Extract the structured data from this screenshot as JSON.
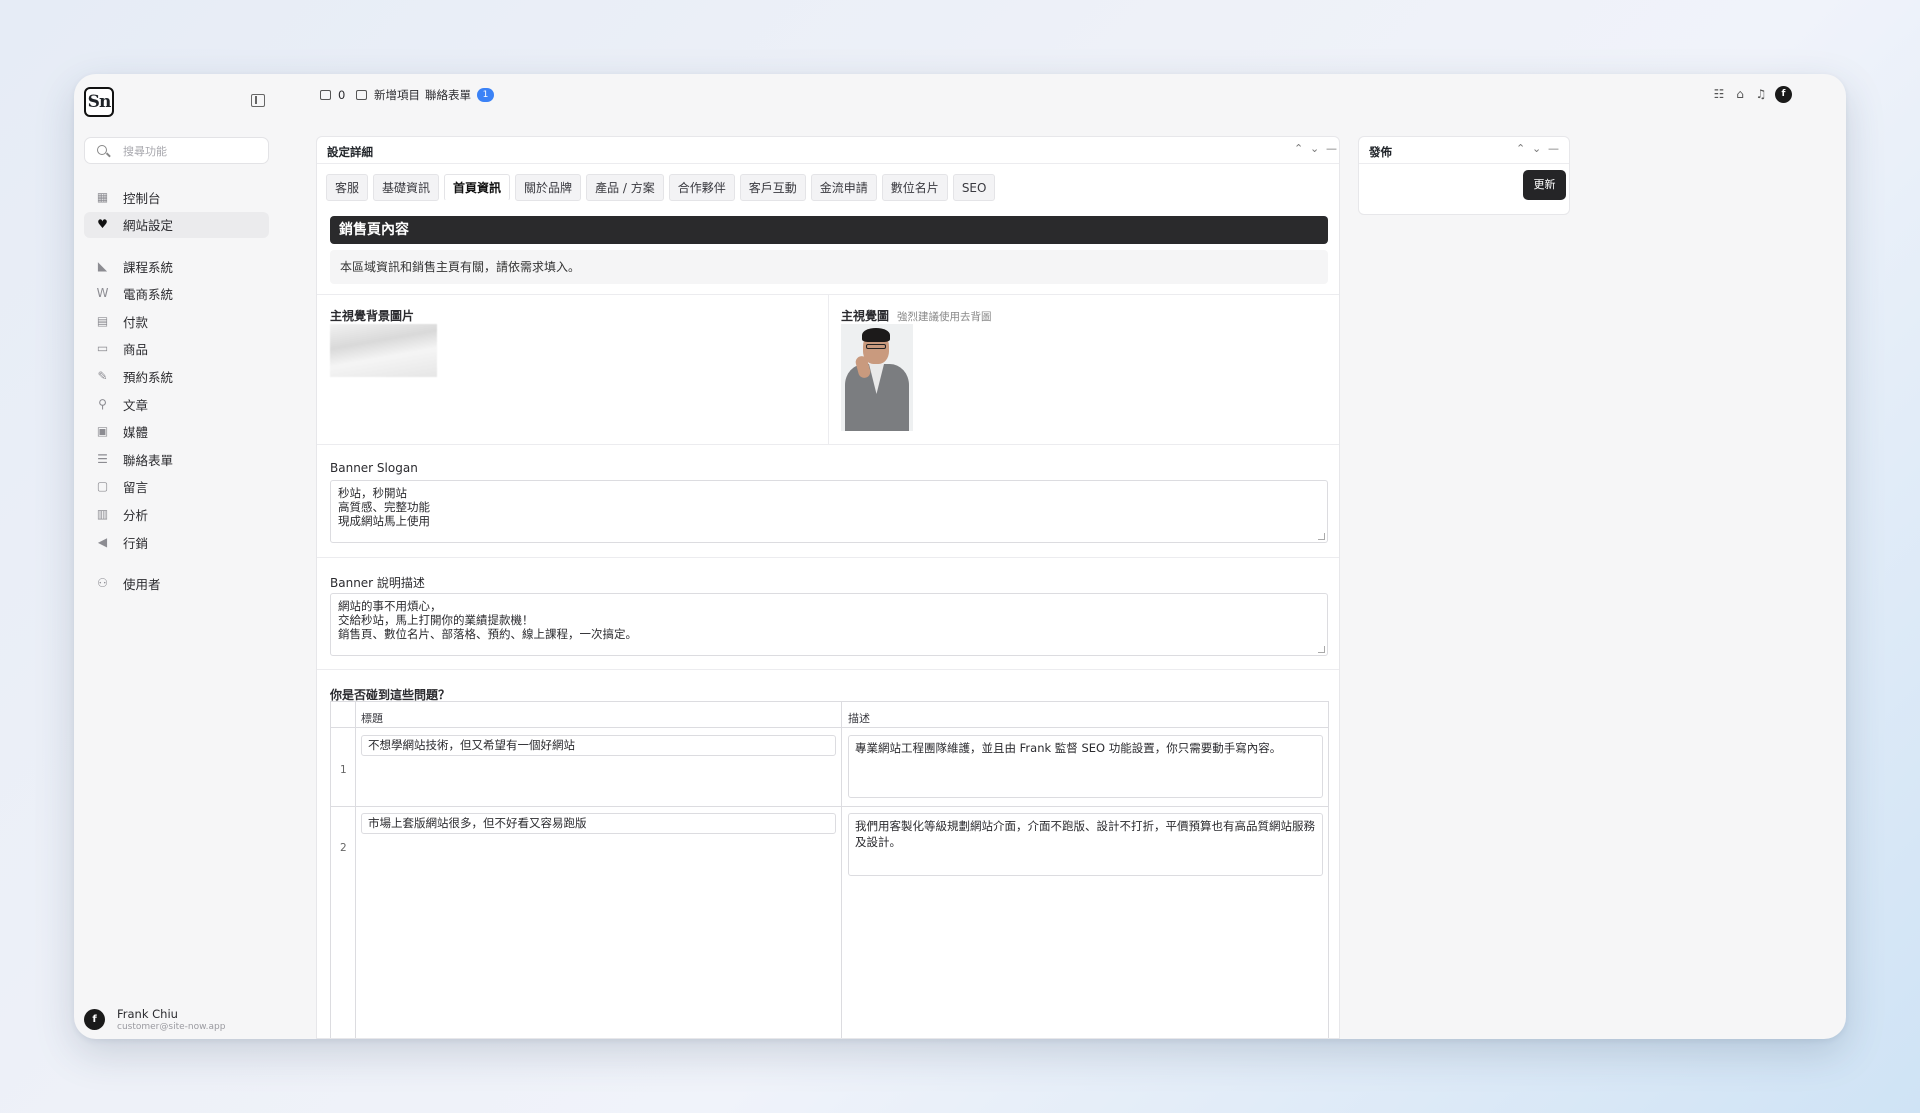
{
  "sidebar": {
    "logo_text": "Sn",
    "search_placeholder": "搜尋功能",
    "items": [
      {
        "label": "控制台",
        "icon": "dashboard-icon"
      },
      {
        "label": "網站設定",
        "icon": "heart-icon",
        "active": true
      },
      {
        "label": "課程系統",
        "icon": "course-icon"
      },
      {
        "label": "電商系統",
        "icon": "woo-icon"
      },
      {
        "label": "付款",
        "icon": "payment-icon"
      },
      {
        "label": "商品",
        "icon": "archive-icon"
      },
      {
        "label": "預約系統",
        "icon": "booking-icon"
      },
      {
        "label": "文章",
        "icon": "pin-icon"
      },
      {
        "label": "媒體",
        "icon": "media-icon"
      },
      {
        "label": "聯絡表單",
        "icon": "form-icon"
      },
      {
        "label": "留言",
        "icon": "comment-icon"
      },
      {
        "label": "分析",
        "icon": "chart-icon"
      },
      {
        "label": "行銷",
        "icon": "megaphone-icon"
      },
      {
        "label": "使用者",
        "icon": "users-icon"
      }
    ],
    "user": {
      "name": "Frank Chiu",
      "email": "customer@site-now.app",
      "avatar_letter": "f"
    }
  },
  "topbar": {
    "comments_count": "0",
    "new_item_label": "新增項目",
    "contact_form_label": "聯絡表單",
    "contact_form_badge": "1",
    "avatar_letter": "f"
  },
  "panel": {
    "title": "設定詳細",
    "tabs": [
      "客服",
      "基礎資訊",
      "首頁資訊",
      "關於品牌",
      "產品 / 方案",
      "合作夥伴",
      "客戶互動",
      "金流申請",
      "數位名片",
      "SEO"
    ],
    "active_tab": "首頁資訊",
    "section_title": "銷售頁內容",
    "notice": "本區域資訊和銷售主頁有關，請依需求填入。",
    "hero_bg_label": "主視覺背景圖片",
    "hero_img_label": "主視覺圖",
    "hero_img_hint": "強烈建議使用去背圖",
    "slogan_label": "Banner Slogan",
    "slogan_value": "秒站，秒開站\n高質感、完整功能\n現成網站馬上使用",
    "desc_label": "Banner 說明描述",
    "desc_value": "網站的事不用煩心，\n交給秒站，馬上打開你的業績提款機！\n銷售頁、數位名片、部落格、預約、線上課程，一次搞定。",
    "faq_label": "你是否碰到這些問題？",
    "faq_headers": {
      "title": "標題",
      "desc": "描述"
    },
    "faq_rows": [
      {
        "num": "1",
        "title": "不想學網站技術，但又希望有一個好網站",
        "desc": "專業網站工程團隊維護，並且由 Frank 監督 SEO 功能設置，你只需要動手寫內容。"
      },
      {
        "num": "2",
        "title": "市場上套版網站很多，但不好看又容易跑版",
        "desc": "我們用客製化等級規劃網站介面，介面不跑版、設計不打折，平價預算也有高品質網站服務及設計。"
      }
    ]
  },
  "publish": {
    "title": "發佈",
    "update_label": "更新"
  }
}
